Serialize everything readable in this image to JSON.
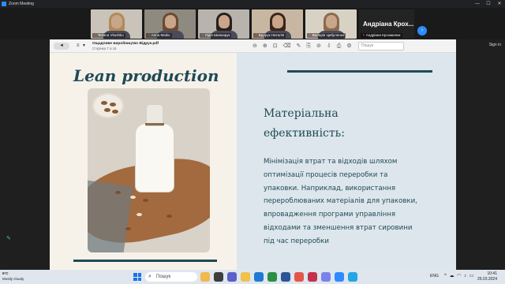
{
  "window": {
    "title": "Zoom Meeting",
    "controls": [
      "—",
      "☐",
      "✕"
    ]
  },
  "gallery": {
    "participants": [
      {
        "name": "Tetiana Vitushko",
        "muted": true
      },
      {
        "name": "Anna Maiko",
        "muted": true
      },
      {
        "name": "Лідія Шинкарук",
        "muted": true
      },
      {
        "name": "Вдорук Наталія",
        "muted": true
      },
      {
        "name": "Валерія Цибуленко",
        "muted": true
      },
      {
        "name": "Андріана Крохмалюк",
        "muted": true
      }
    ],
    "active_speaker_label": "Андріана Крох...",
    "next_icon": "chevron-right-icon"
  },
  "signin_label": "Sign in",
  "viewer": {
    "back_label": "◄",
    "sidebar_icon": "≡",
    "sidebar_icon2": "▾",
    "doc_name": "Ощадливе виробництво Відрук.pdf",
    "page_info": "Сторінка 7 із 16",
    "tools": [
      "⊖",
      "⊕",
      "⊡",
      "⌫",
      "✎",
      "⎘",
      "⊘",
      "⇩",
      "⎙",
      "⚙"
    ],
    "search_placeholder": "Пошук"
  },
  "slide": {
    "left_title": "Lean production",
    "right_title": "Матеріальна ефективність:",
    "body": "Мінімізація втрат та відходів шляхом оптимізації процесів переробки та упаковки. Наприклад, використання перероблюваних матеріалів для упаковки, впровадження програми управління відходами та зменшення втрат сировини під час переробки",
    "colors": {
      "accent": "#1f4a56",
      "left_bg": "#f6f2ea",
      "right_bg": "#dde6ec"
    }
  },
  "taskbar": {
    "weather_temp": "5°C",
    "weather_text": "Mostly cloudy",
    "search_label": "Пошук",
    "language": "ENG",
    "time": "10:41",
    "date": "26.03.2024",
    "tray_icons": "^ ☁ ◠ ♪ ▭"
  }
}
